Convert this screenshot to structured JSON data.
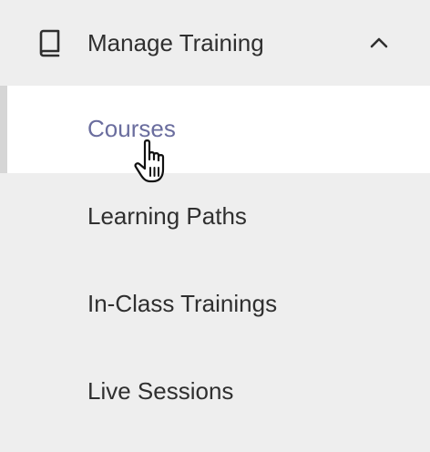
{
  "menu": {
    "header": {
      "label": "Manage Training",
      "icon": "book-icon",
      "toggle_icon": "chevron-up-icon",
      "expanded": true
    },
    "items": [
      {
        "label": "Courses",
        "active": true,
        "hovered": true
      },
      {
        "label": "Learning Paths",
        "active": false
      },
      {
        "label": "In-Class Trainings",
        "active": false
      },
      {
        "label": "Live Sessions",
        "active": false
      }
    ]
  },
  "colors": {
    "background": "#eeeeee",
    "active_background": "#ffffff",
    "active_text": "#6a6d9e",
    "text": "#2f2f2f",
    "active_indicator": "#d6d6d6"
  },
  "cursor": {
    "icon": "hand-pointer-cursor-icon"
  }
}
